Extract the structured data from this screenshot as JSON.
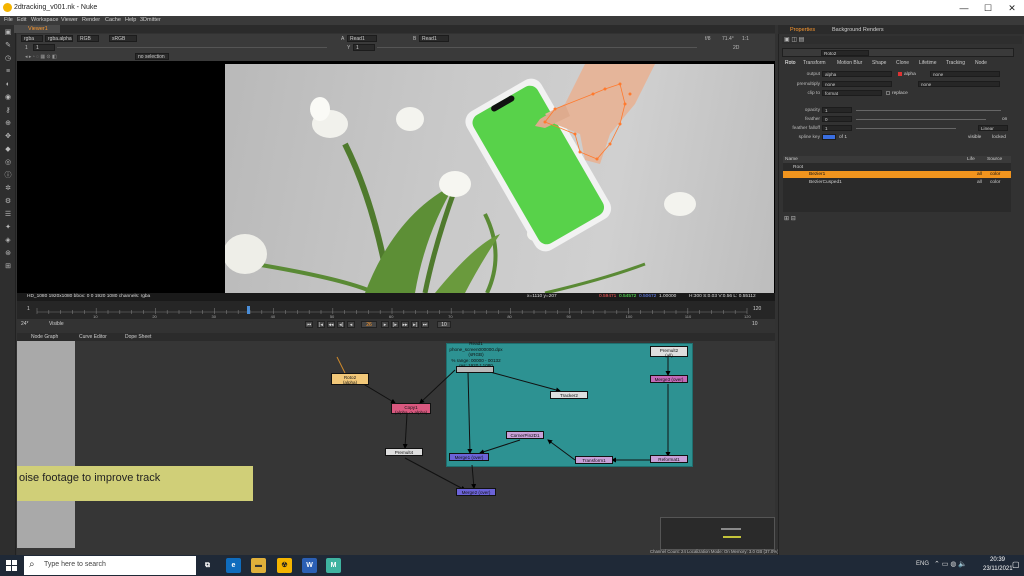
{
  "window": {
    "title": "2dtracking_v001.nk - Nuke",
    "btn_min": "—",
    "btn_max": "☐",
    "btn_close": "✕"
  },
  "menu": [
    "File",
    "Edit",
    "Workspace",
    "Viewer",
    "Render",
    "Cache",
    "Help",
    "3Dmitter"
  ],
  "viewer": {
    "tab": "Viewer1",
    "channels": "rgba",
    "alpha": "rgba.alpha",
    "colorspace": "RGB",
    "display": "sRGB",
    "input_a": "A",
    "input_a_node": "Read1",
    "input_b": "B",
    "input_b_node": "Read1",
    "fstop_label": "f/8",
    "zoom": "1:1",
    "gain_label": "1",
    "gain_value": "1",
    "gamma_label": "Y",
    "gamma_value": "1",
    "proxy_label": "2D",
    "roi": "no selection",
    "right_value": "71.4°"
  },
  "infobar": {
    "left": "HD_1080 1920x1080  bbox: 0 0 1920 1080 channels: rgba",
    "coords": "x=1110 y=207",
    "r": "0.59471",
    "g": "0.54572",
    "b": "0.50672",
    "a": "1.00000",
    "hsvl": "H:300 S:0.03 V:0.56  L: 0.55112"
  },
  "timeline": {
    "start": "1",
    "end": "120",
    "marks": [
      "10",
      "20",
      "30",
      "40",
      "50",
      "60",
      "70",
      "80",
      "90",
      "100",
      "110",
      "120"
    ],
    "current": "26",
    "fps": "24*",
    "range": "Visible",
    "frame_field": "26",
    "frame_counter": "10",
    "step": "10"
  },
  "nodegraph": {
    "tabs": [
      "Node Graph",
      "Curve Editor",
      "Dope Sheet"
    ],
    "sticky": "oise footage to improve track",
    "nodes": [
      {
        "label": "Roto2",
        "sub": "(alpha)"
      },
      {
        "label": "Copy1",
        "sub": "(alpha -> alpha)"
      },
      {
        "label": "Premult4",
        "sub": ""
      },
      {
        "label": "Read1",
        "sub": "phone_screen000000.dpx"
      },
      {
        "label": "Premult2",
        "sub": "(all)"
      },
      {
        "label": "Merge1 (over)",
        "sub": ""
      },
      {
        "label": "Tracker2",
        "sub": ""
      },
      {
        "label": "CornerPin2D1",
        "sub": ""
      },
      {
        "label": "Merge2 (over)",
        "sub": ""
      },
      {
        "label": "Transform1",
        "sub": ""
      },
      {
        "label": "Reformat1",
        "sub": ""
      },
      {
        "label": "Merge3 (over)",
        "sub": ""
      }
    ],
    "read_info": [
      "(sRGB)",
      "% range: 00000 - 00132",
      "res: 1920 * 1080"
    ],
    "status": "Channel Count: 24  Localization Mode: On  Memory: 3.0 GB (37.0%)  CPU: 9.4%  Disk: 0.0 MB/s  Network: 0.0 MB/s"
  },
  "properties": {
    "tabs": [
      "Properties",
      "Background Renders"
    ],
    "node_name": "Roto2",
    "subtabs": [
      "Roto",
      "Transform",
      "Motion Blur",
      "Shape",
      "Clone",
      "Lifetime",
      "Tracking",
      "Node"
    ],
    "output_label": "output",
    "output_value": "alpha",
    "alpha_label": "alpha",
    "alpha_value": "none",
    "premult_label": "premultiply",
    "premult_value": "none",
    "premult_value2": "none",
    "clip_label": "clip to",
    "clip_value": "format",
    "replace_label": "replace",
    "opacity_label": "opacity",
    "opacity_value": "1",
    "feather_label": "feather",
    "feather_value": "0",
    "on_label": "on",
    "falloff_label": "feather falloff",
    "falloff_value": "1",
    "falloff_type": "Linear",
    "splinekey_label": "spline key",
    "splinekey_of": "of 1",
    "visible_label": "visible",
    "locked_label": "locked",
    "table_headers": [
      "Name",
      "Life",
      "Source"
    ],
    "rows": [
      {
        "name": "Root",
        "life": "",
        "source": ""
      },
      {
        "name": "Bezier1",
        "life": "all",
        "source": "color"
      },
      {
        "name": "BezierCusped1",
        "life": "all",
        "source": "color"
      }
    ]
  },
  "taskbar": {
    "search_placeholder": "Type here to search",
    "time": "20:39",
    "date": "23/11/2021",
    "lang": "ENG"
  },
  "colors": {
    "accent": "#ff9a2e",
    "backdrop": "#2d9292",
    "sticky": "#d0cf78",
    "roto": "#f2c879",
    "copy": "#d9587f",
    "merge": "#6b63d8",
    "tracker": "#dedede",
    "transform": "#c8a0d8"
  }
}
